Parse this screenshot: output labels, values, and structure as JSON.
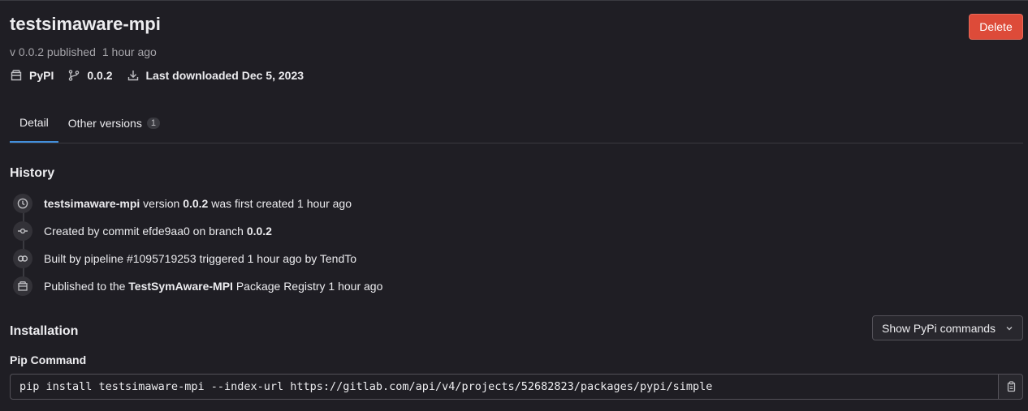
{
  "package": {
    "name": "testsimaware-mpi",
    "version_line": "v 0.0.2 published",
    "published_ago": "1 hour ago",
    "type": "PyPI",
    "branch": "0.0.2",
    "last_downloaded": "Last downloaded Dec 5, 2023"
  },
  "actions": {
    "delete_label": "Delete"
  },
  "tabs": [
    {
      "label": "Detail",
      "active": true
    },
    {
      "label": "Other versions",
      "count": "1",
      "active": false
    }
  ],
  "history": {
    "heading": "History",
    "items": [
      {
        "icon": "clock-icon",
        "bold1": "testsimaware-mpi",
        "text1": " version ",
        "bold2": "0.0.2",
        "text2": " was first created 1 hour ago"
      },
      {
        "icon": "commit-icon",
        "text1": "Created by commit efde9aa0 on branch ",
        "bold1": "0.0.2"
      },
      {
        "icon": "pipeline-icon",
        "text1": "Built by pipeline #1095719253 triggered 1 hour ago by TendTo"
      },
      {
        "icon": "package-icon",
        "text1": "Published to the ",
        "bold1": "TestSymAware-MPI",
        "text2": " Package Registry 1 hour ago"
      }
    ]
  },
  "installation": {
    "heading": "Installation",
    "show_commands_label": "Show PyPi commands",
    "pip_label": "Pip Command",
    "pip_command": "pip install testsimaware-mpi --index-url https://gitlab.com/api/v4/projects/52682823/packages/pypi/simple"
  }
}
